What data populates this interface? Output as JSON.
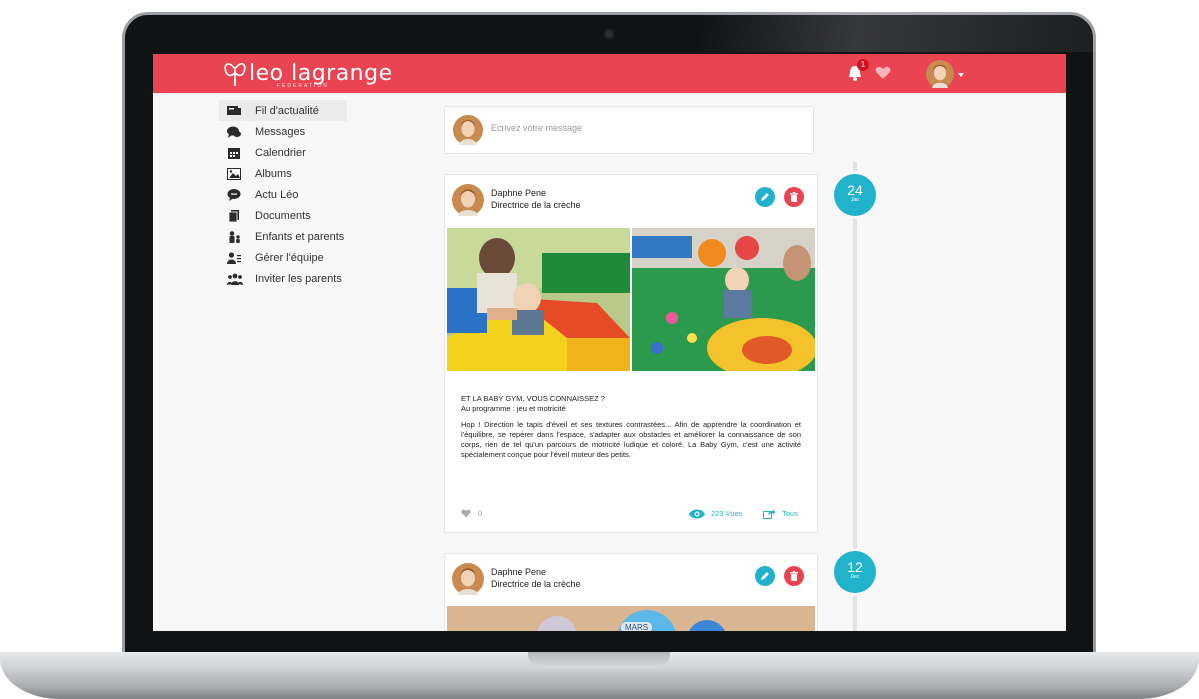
{
  "brand": {
    "name": "leo lagrange",
    "subtitle": "FEDERATION"
  },
  "notifications": {
    "count": "1"
  },
  "sidebar": {
    "items": [
      {
        "label": "Fil d'actualité",
        "icon": "newspaper-icon",
        "active": true
      },
      {
        "label": "Messages",
        "icon": "chat-bubbles-icon"
      },
      {
        "label": "Calendrier",
        "icon": "calendar-icon"
      },
      {
        "label": "Albums",
        "icon": "picture-icon"
      },
      {
        "label": "Actu Léo",
        "icon": "speech-bubble-icon"
      },
      {
        "label": "Documents",
        "icon": "documents-icon"
      },
      {
        "label": "Enfants et parents",
        "icon": "family-icon"
      },
      {
        "label": "Gérer l'équipe",
        "icon": "team-manage-icon"
      },
      {
        "label": "Inviter les parents",
        "icon": "group-icon"
      }
    ]
  },
  "composer": {
    "placeholder": "Ecrivez votre message"
  },
  "posts": [
    {
      "date_day": "24",
      "date_month": "Jan",
      "author": "Daphne Pene",
      "role": "Directrice de la crèche",
      "title": "ET LA BABY GYM, VOUS CONNAISSEZ ?",
      "subtitle": "Au programme : jeu et motricité",
      "body": "Hop ! Direction le tapis d'éveil et ses textures contrastées... Afin de apprendre la coordination et l'équilibre, se repérer dans l'espace, s'adapter aux obstacles et améliorer la connaissance de son corps, rien de tel qu'un parcours de motricité ludique et coloré. La Baby Gym, c'est une activité spécialement conçue pour l'éveil moteur des petits.",
      "likes": "0",
      "views": "223 Vues",
      "share": "Tous"
    },
    {
      "date_day": "12",
      "date_month": "Dec",
      "author": "Daphne Pene",
      "role": "Directrice de la crèche",
      "photo_label": "MARS"
    }
  ],
  "colors": {
    "brand_red": "#ea4453",
    "accent_teal": "#22b3cc"
  }
}
